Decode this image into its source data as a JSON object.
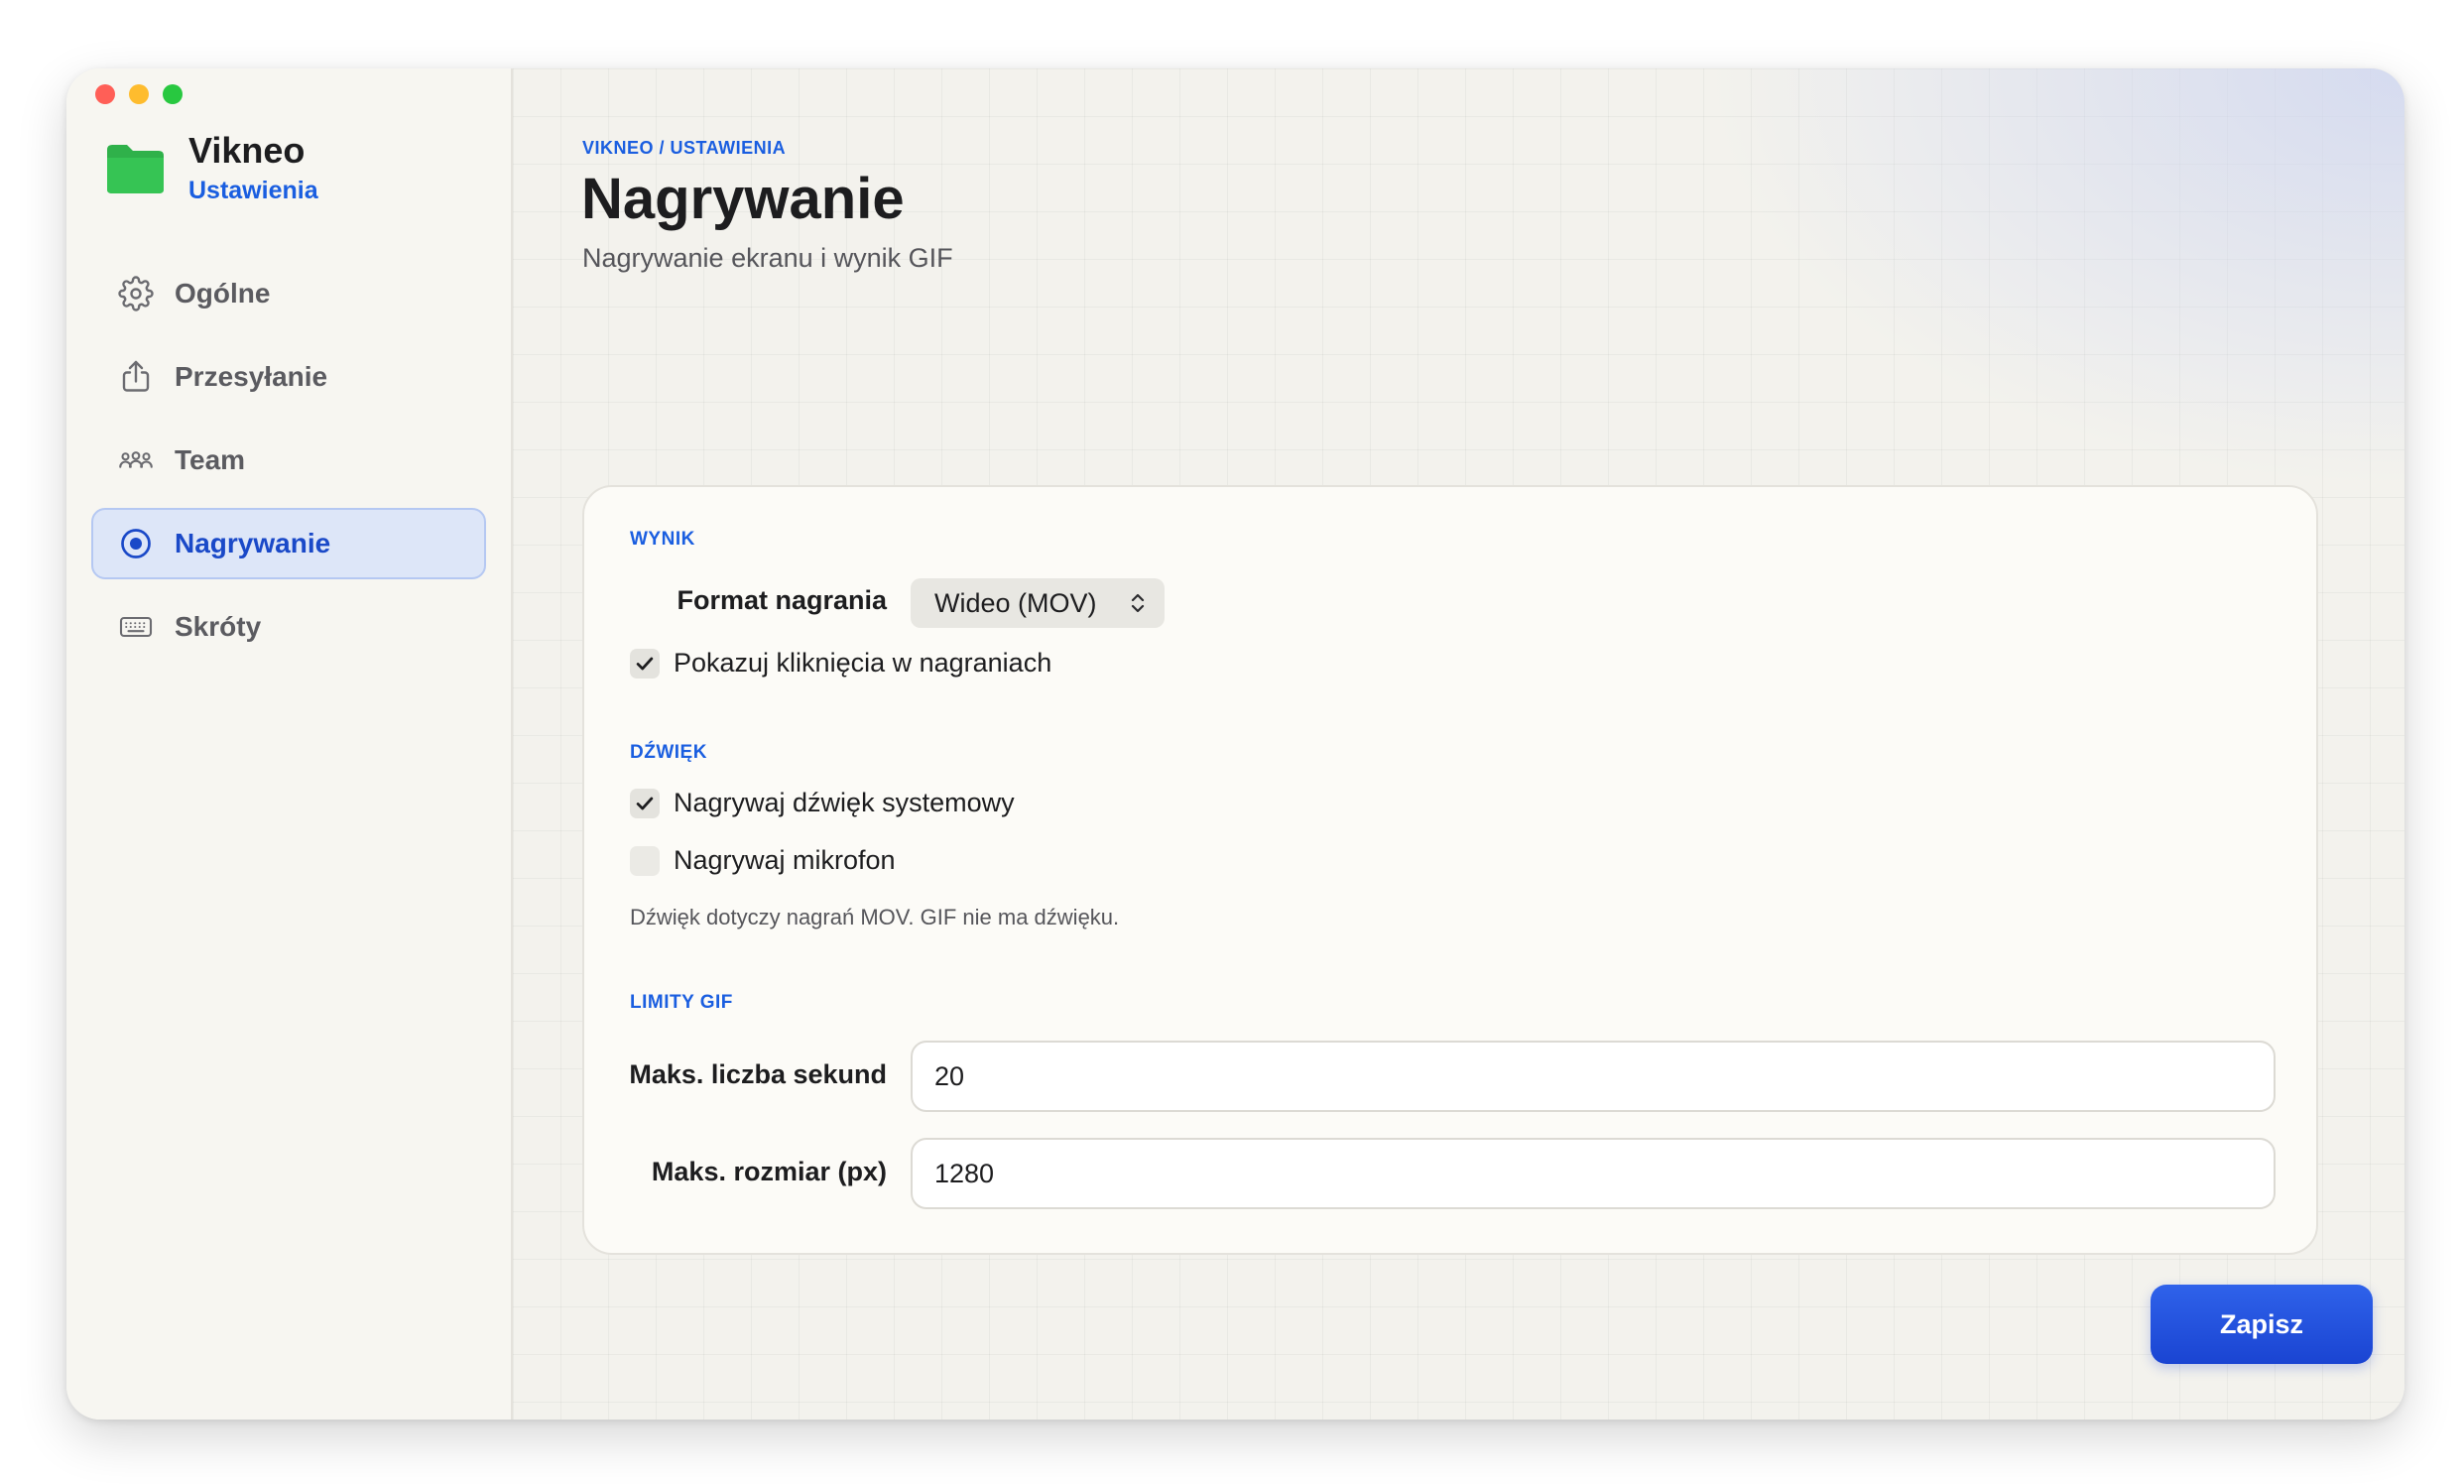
{
  "window": {
    "controls": [
      "close",
      "minimize",
      "maximize"
    ]
  },
  "sidebar": {
    "app_title": "Vikneo",
    "app_subtitle": "Ustawienia",
    "items": [
      {
        "label": "Ogólne",
        "icon": "gear-icon",
        "active": false
      },
      {
        "label": "Przesyłanie",
        "icon": "share-icon",
        "active": false
      },
      {
        "label": "Team",
        "icon": "people-icon",
        "active": false
      },
      {
        "label": "Nagrywanie",
        "icon": "record-icon",
        "active": true
      },
      {
        "label": "Skróty",
        "icon": "keyboard-icon",
        "active": false
      }
    ]
  },
  "main": {
    "breadcrumb": "VIKNEO / USTAWIENIA",
    "title": "Nagrywanie",
    "subtitle": "Nagrywanie ekranu i wynik GIF"
  },
  "card": {
    "output": {
      "section": "WYNIK",
      "format_label": "Format nagrania",
      "format_value": "Wideo (MOV)",
      "show_clicks_label": "Pokazuj kliknięcia w nagraniach",
      "show_clicks_checked": true
    },
    "sound": {
      "section": "DŹWIĘK",
      "system_audio_label": "Nagrywaj dźwięk systemowy",
      "system_audio_checked": true,
      "mic_label": "Nagrywaj mikrofon",
      "mic_checked": false,
      "note": "Dźwięk dotyczy nagrań MOV. GIF nie ma dźwięku."
    },
    "gif_limits": {
      "section": "LIMITY GIF",
      "max_seconds_label": "Maks. liczba sekund",
      "max_seconds_value": "20",
      "max_size_label": "Maks. rozmiar (px)",
      "max_size_value": "1280"
    }
  },
  "footer": {
    "save_label": "Zapisz"
  },
  "colors": {
    "accent": "#1a5ee0",
    "button": "#1f4bd8",
    "active_nav_bg": "#dde6f8"
  }
}
